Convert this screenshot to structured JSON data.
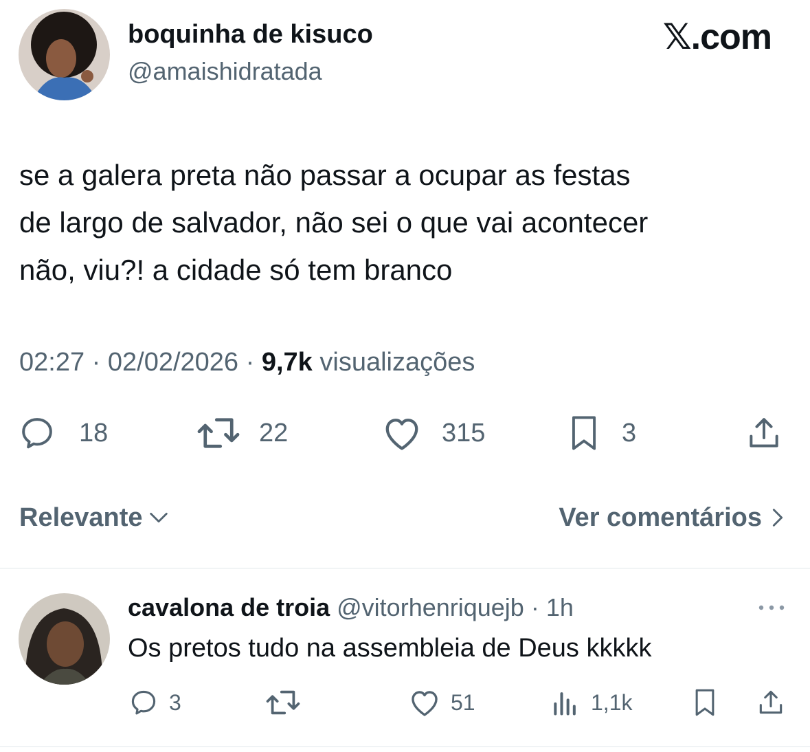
{
  "tweet": {
    "author_name": "boquinha de kisuco",
    "author_handle": "@amaishidratada",
    "brand": "𝕏.com",
    "text_lines": [
      "se a galera preta não passar a ocupar as festas",
      "de largo de salvador, não sei o que vai acontecer",
      "não, viu?! a cidade só tem branco"
    ],
    "time": "02:27",
    "date": "02/02/2026",
    "views_count": "9,7k",
    "views_label": "visualizações",
    "replies": "18",
    "retweets": "22",
    "likes": "315",
    "bookmarks": "3"
  },
  "comments_bar": {
    "sort_label": "Relevante",
    "view_comments_label": "Ver comentários"
  },
  "reply": {
    "author_name": "cavalona de troia",
    "author_handle": "@vitorhenriquejb",
    "time": "1h",
    "text": "Os pretos tudo na assembleia de Deus kkkkk",
    "replies": "3",
    "likes": "51",
    "views": "1,1k"
  },
  "colors": {
    "text": "#0f1419",
    "muted": "#536471",
    "divider": "#e1e6ea"
  }
}
